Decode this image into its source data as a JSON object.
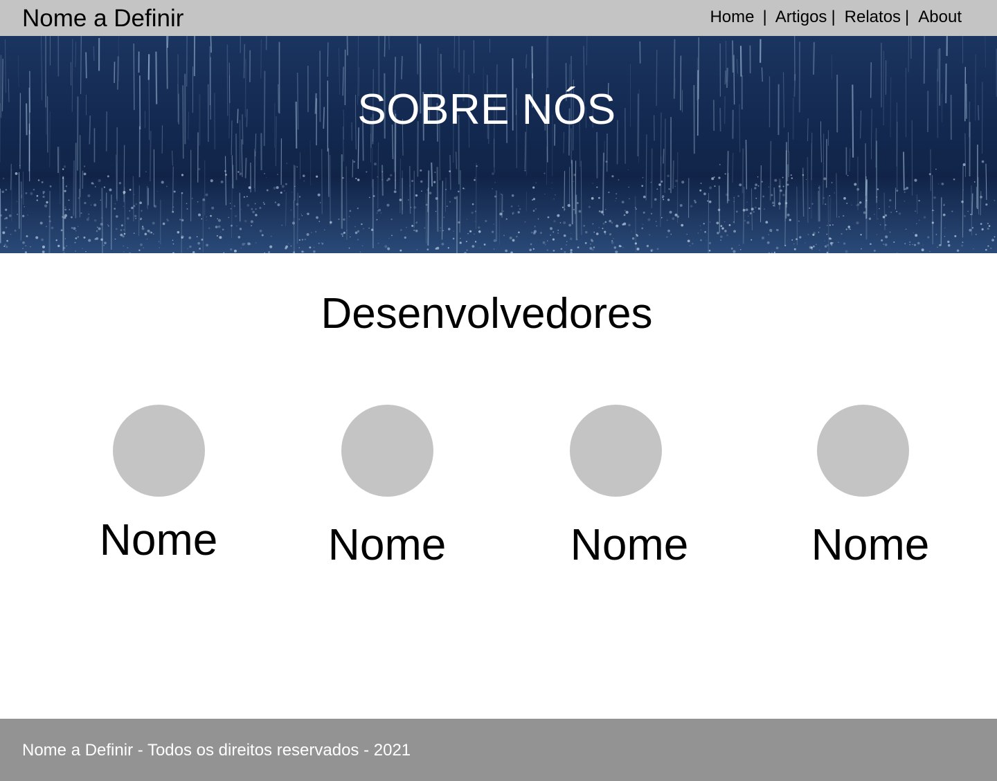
{
  "header": {
    "brand": "Nome a Definir",
    "nav": [
      {
        "label": "Home"
      },
      {
        "label": "Artigos"
      },
      {
        "label": "Relatos"
      },
      {
        "label": "About"
      }
    ],
    "separator": "|"
  },
  "hero": {
    "title": "SOBRE NÓS"
  },
  "developers": {
    "title": "Desenvolvedores",
    "members": [
      {
        "name": "Nome"
      },
      {
        "name": "Nome"
      },
      {
        "name": "Nome"
      },
      {
        "name": "Nome"
      }
    ]
  },
  "footer": {
    "text": "Nome a Definir - Todos os direitos reservados - 2021"
  },
  "colors": {
    "topbar": "#c4c4c4",
    "footer": "#939393",
    "avatar_placeholder": "#c4c4c4",
    "hero_background": "#142a52"
  }
}
